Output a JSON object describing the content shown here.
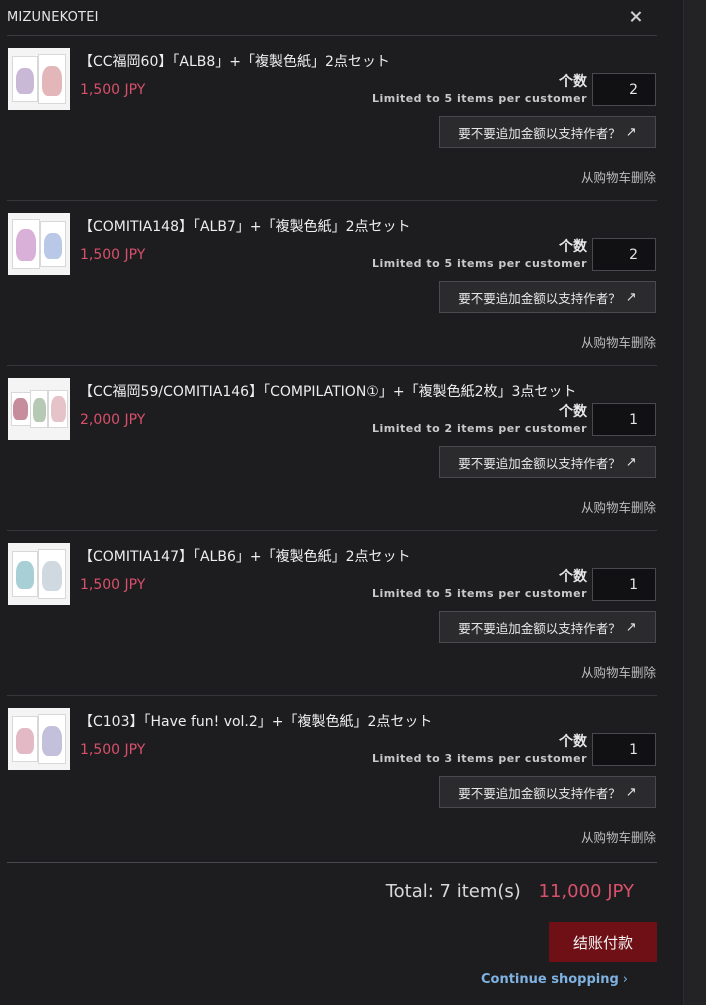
{
  "header": {
    "store_name": "MIZUNEKOTEI",
    "close_icon": "close-icon"
  },
  "qty_label": "个数",
  "support_label": "要不要追加金额以支持作者？",
  "remove_label": "从购物车删除",
  "items": [
    {
      "title": "【CC福岡60】「ALB8」+「複製色紙」2点セット",
      "price": "1,500 JPY",
      "limit": "Limited to 5 items per customer",
      "quantity": "2"
    },
    {
      "title": "【COMITIA148】「ALB7」+「複製色紙」2点セット",
      "price": "1,500 JPY",
      "limit": "Limited to 5 items per customer",
      "quantity": "2"
    },
    {
      "title": "【CC福岡59/COMITIA146】「COMPILATION①」+「複製色紙2枚」3点セット",
      "price": "2,000 JPY",
      "limit": "Limited to 2 items per customer",
      "quantity": "1"
    },
    {
      "title": "【COMITIA147】「ALB6」+「複製色紙」2点セット",
      "price": "1,500 JPY",
      "limit": "Limited to 5 items per customer",
      "quantity": "1"
    },
    {
      "title": "【C103】「Have fun! vol.2」+「複製色紙」2点セット",
      "price": "1,500 JPY",
      "limit": "Limited to 3 items per customer",
      "quantity": "1"
    }
  ],
  "summary": {
    "total_label": "Total:",
    "item_count": "7 item(s)",
    "total_amount": "11,000 JPY",
    "checkout_label": "结账付款",
    "continue_label": "Continue shopping",
    "continue_icon": "›"
  },
  "colors": {
    "price": "#d9506a",
    "checkout": "#6e1016",
    "link": "#7fb2e0",
    "background": "#1d1d20"
  }
}
